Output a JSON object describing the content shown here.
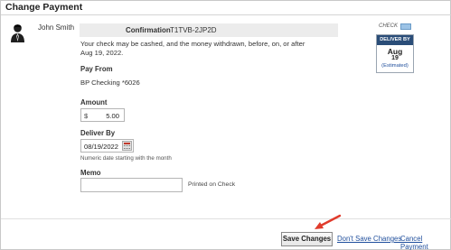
{
  "dialog": {
    "title": "Change Payment"
  },
  "payee": {
    "name": "John Smith"
  },
  "confirmation": {
    "label": "Confirmation",
    "number": "T1TVB-2JP2D"
  },
  "notice": "Your check may be cashed, and the money withdrawn, before, on, or after Aug 19, 2022.",
  "pay_from": {
    "label": "Pay From",
    "account": "BP Checking *6026"
  },
  "amount": {
    "label": "Amount",
    "currency_symbol": "$",
    "value": "5.00"
  },
  "deliver_by": {
    "label": "Deliver By",
    "date": "08/19/2022",
    "hint": "Numeric date starting with the month"
  },
  "memo": {
    "label": "Memo",
    "value": "",
    "hint": "Printed on Check"
  },
  "badge": {
    "method": "CHECK",
    "header": "DELIVER BY",
    "month": "Aug",
    "day": "19",
    "estimated": "(Estimated)"
  },
  "actions": {
    "save": "Save Changes",
    "dont_save": "Don't Save Changes",
    "cancel": "Cancel Payment"
  },
  "colors": {
    "badge_header": "#2a4d78",
    "link": "#1f4e9c",
    "annotation_arrow": "#e03b2c"
  },
  "icons": {
    "avatar": "person-icon",
    "check": "check-card-icon",
    "calendar": "calendar-icon",
    "annotation": "red-arrow-icon"
  }
}
